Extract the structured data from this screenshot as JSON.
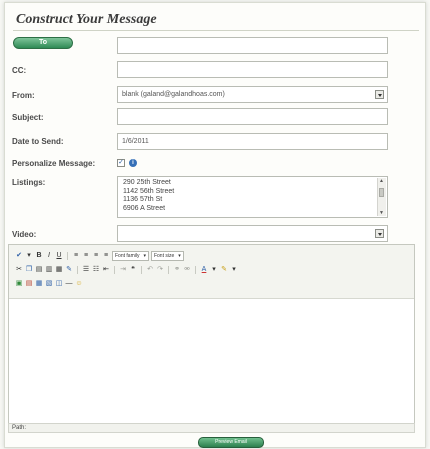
{
  "form": {
    "title": "Construct Your Message",
    "to_button": "To",
    "cc_label": "CC:",
    "from_label": "From:",
    "from_value": "blank (galand@galandhoas.com)",
    "subject_label": "Subject:",
    "date_label": "Date to Send:",
    "date_value": "1/6/2011",
    "personalize_label": "Personalize Message:",
    "personalize_checked": true,
    "listings_label": "Listings:",
    "listings": [
      "290 25th Street",
      "1142 56th Street",
      "1136 57th St",
      "6906 A Street"
    ],
    "video_label": "Video:"
  },
  "editor": {
    "font_family": "Font family",
    "font_size": "Font size",
    "path_label": "Path:"
  },
  "footer": {
    "preview_button": "Preview Email"
  },
  "colors": {
    "button_green": "#2f8a55",
    "link_blue": "#3570b8"
  }
}
